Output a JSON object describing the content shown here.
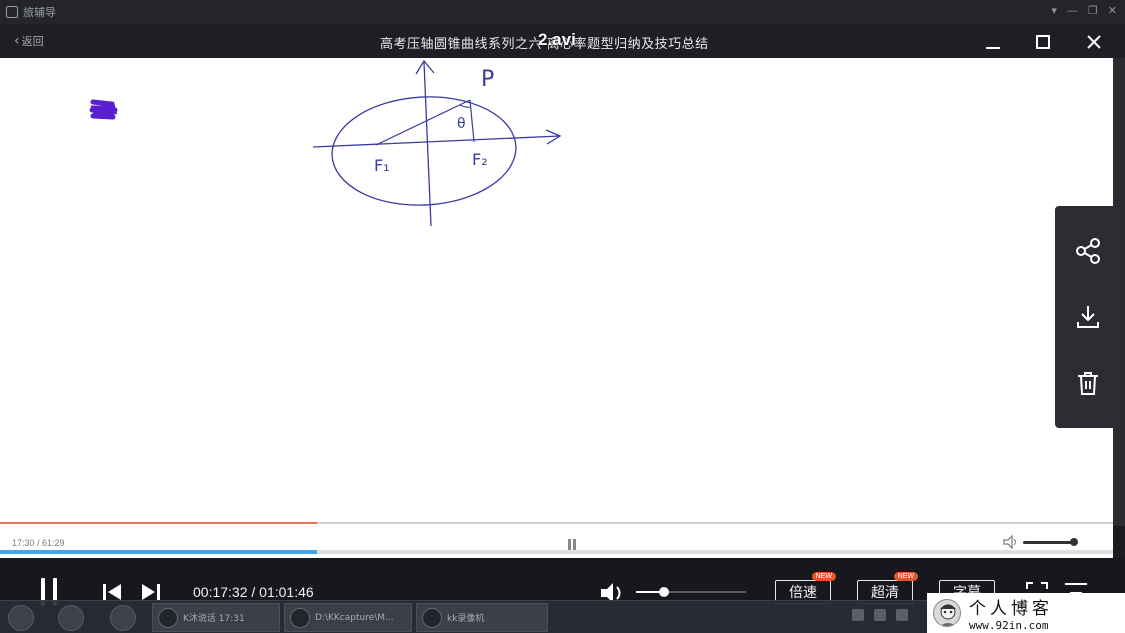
{
  "outer_window": {
    "app_name": "旅辅导",
    "controls": [
      "▾",
      "—",
      "❐",
      "✕"
    ]
  },
  "title_bar": {
    "back_label": "返回",
    "video_title": "高考压轴圆锥曲线系列之六 离心率题型归纳及技巧总结",
    "file_name": "2.avi"
  },
  "whiteboard": {
    "labels": {
      "p": "P",
      "theta": "θ",
      "f1": "F₁",
      "f2": "F₂"
    }
  },
  "inner_player": {
    "progress": 0.285,
    "time_text": "17:30 / 61:29",
    "volume": 1.0,
    "buffer_progress": 0.285
  },
  "controls": {
    "time_text": "00:17:32 / 01:01:46",
    "volume_level": 0.25,
    "speed_label": "倍速",
    "speed_badge": "NEW",
    "quality_label": "超清",
    "quality_badge": "NEW",
    "subtitle_label": "字幕"
  },
  "taskbar": {
    "items": [
      {
        "label": "K沐说话 17:31"
      },
      {
        "label": "D:\\KKcapture\\M..."
      },
      {
        "label": "kk录像机"
      }
    ]
  },
  "watermark": {
    "title": "个人博客",
    "url": "www.92in.com"
  },
  "colors": {
    "accent_orange": "#e8734a",
    "progress_blue": "#3fa6e8",
    "badge_red": "#e4552a",
    "ink": "#3b3aa0"
  }
}
